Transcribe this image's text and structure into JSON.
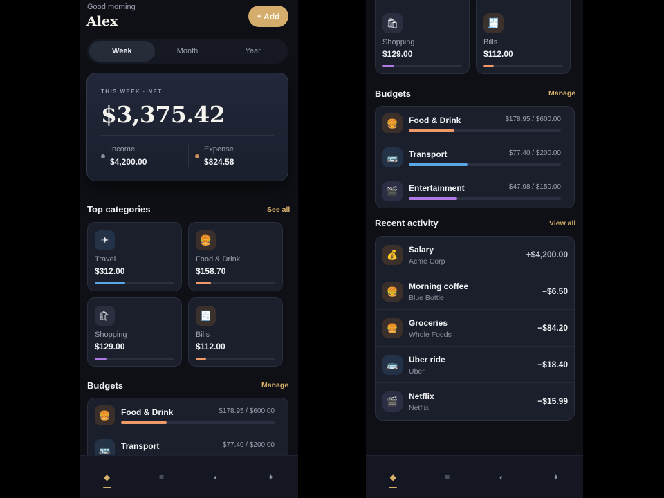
{
  "colors": {
    "accent": "#d4ad6d",
    "income_dot": "#8c8f99",
    "expense_dot": "#c8905a",
    "travel": "#5aa6e6",
    "food": "#f09a6a",
    "shopping": "#b07ae6",
    "bills": "#f09a6a",
    "transport": "#5aa6e6",
    "entertainment": "#b07ae6"
  },
  "left": {
    "header": {
      "greeting": "Good morning",
      "name": "Alex",
      "add_label": "Add",
      "add_icon": "plus-icon"
    },
    "period_tabs": [
      {
        "label": "Week",
        "active": true
      },
      {
        "label": "Month",
        "active": false
      },
      {
        "label": "Year",
        "active": false
      }
    ],
    "net": {
      "eyebrow": "THIS WEEK · NET",
      "amount": "$3,375.42",
      "income_label": "Income",
      "income_value": "$4,200.00",
      "expense_label": "Expense",
      "expense_value": "$824.58"
    },
    "top_categories": {
      "title": "Top categories",
      "link": "See all",
      "items": [
        {
          "label": "Travel",
          "value": "$312.00",
          "icon": "airplane-icon",
          "glyph": "✈",
          "progress": 0.38
        },
        {
          "label": "Food & Drink",
          "value": "$158.70",
          "icon": "burger-icon",
          "glyph": "🍔",
          "progress": 0.19
        },
        {
          "label": "Shopping",
          "value": "$129.00",
          "icon": "shopping-bag-icon",
          "glyph": "🛍",
          "progress": 0.15
        },
        {
          "label": "Bills",
          "value": "$112.00",
          "icon": "receipt-icon",
          "glyph": "🧾",
          "progress": 0.13
        }
      ]
    },
    "budgets": {
      "title": "Budgets",
      "link": "Manage",
      "items": [
        {
          "name": "Food & Drink",
          "amount": "$178.95 / $600.00",
          "icon": "burger-icon",
          "glyph": "🍔",
          "progress": 0.298
        },
        {
          "name": "Transport",
          "amount": "$77.40 / $200.00",
          "icon": "bus-icon",
          "glyph": "🚌",
          "progress": 0.387
        }
      ]
    }
  },
  "right": {
    "top_categories": {
      "items": [
        {
          "label": "Shopping",
          "value": "$129.00",
          "icon": "shopping-bag-icon",
          "glyph": "🛍",
          "progress": 0.15
        },
        {
          "label": "Bills",
          "value": "$112.00",
          "icon": "receipt-icon",
          "glyph": "🧾",
          "progress": 0.13
        }
      ]
    },
    "budgets": {
      "title": "Budgets",
      "link": "Manage",
      "items": [
        {
          "name": "Food & Drink",
          "amount": "$178.95 / $600.00",
          "icon": "burger-icon",
          "glyph": "🍔",
          "progress": 0.298
        },
        {
          "name": "Transport",
          "amount": "$77.40 / $200.00",
          "icon": "bus-icon",
          "glyph": "🚌",
          "progress": 0.387
        },
        {
          "name": "Entertainment",
          "amount": "$47.98 / $150.00",
          "icon": "film-icon",
          "glyph": "🎬",
          "progress": 0.32
        }
      ]
    },
    "activity": {
      "title": "Recent activity",
      "link": "View all",
      "items": [
        {
          "title": "Salary",
          "sub": "Acme Corp",
          "amount": "+$4,200.00",
          "icon": "money-bag-icon",
          "glyph": "💰",
          "positive": true
        },
        {
          "title": "Morning coffee",
          "sub": "Blue Bottle",
          "amount": "−$6.50",
          "icon": "burger-icon",
          "glyph": "🍔",
          "positive": false
        },
        {
          "title": "Groceries",
          "sub": "Whole Foods",
          "amount": "−$84.20",
          "icon": "burger-icon",
          "glyph": "🍔",
          "positive": false
        },
        {
          "title": "Uber ride",
          "sub": "Uber",
          "amount": "−$18.40",
          "icon": "bus-icon",
          "glyph": "🚌",
          "positive": false
        },
        {
          "title": "Netflix",
          "sub": "Netflix",
          "amount": "−$15.99",
          "icon": "film-icon",
          "glyph": "🎬",
          "positive": false
        }
      ]
    }
  },
  "nav": {
    "items": [
      {
        "icon": "home-diamond-icon",
        "glyph": "◆",
        "active": true
      },
      {
        "icon": "list-icon",
        "glyph": "≡",
        "active": false
      },
      {
        "icon": "contrast-icon",
        "glyph": "◐",
        "active": false
      },
      {
        "icon": "sparkle-icon",
        "glyph": "✦",
        "active": false
      }
    ]
  }
}
